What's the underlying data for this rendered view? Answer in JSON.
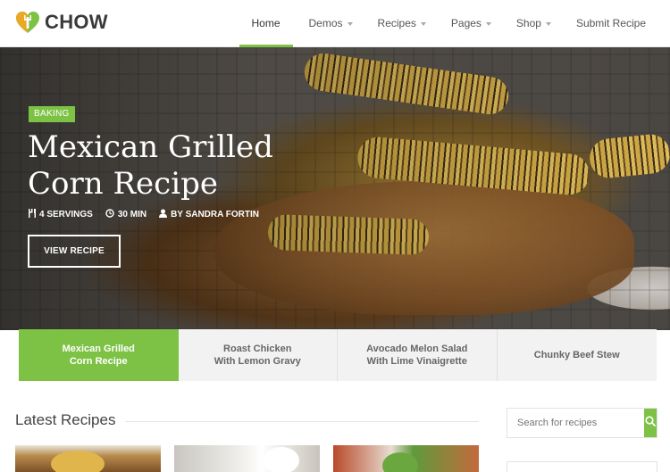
{
  "brand": {
    "name": "CHOW",
    "accent": "#7dc245"
  },
  "nav": {
    "items": [
      {
        "label": "Home",
        "active": true,
        "dropdown": false
      },
      {
        "label": "Demos",
        "active": false,
        "dropdown": true
      },
      {
        "label": "Recipes",
        "active": false,
        "dropdown": true
      },
      {
        "label": "Pages",
        "active": false,
        "dropdown": true
      },
      {
        "label": "Shop",
        "active": false,
        "dropdown": true
      },
      {
        "label": "Submit Recipe",
        "active": false,
        "dropdown": false
      }
    ]
  },
  "hero": {
    "category": "BAKING",
    "title": "Mexican Grilled Corn Recipe",
    "servings": "4 SERVINGS",
    "time": "30 MIN",
    "author": "BY SANDRA FORTIN",
    "cta": "VIEW RECIPE"
  },
  "slider_tabs": [
    {
      "line1": "Mexican Grilled",
      "line2": "Corn Recipe",
      "active": true
    },
    {
      "line1": "Roast Chicken",
      "line2": "With Lemon Gravy",
      "active": false
    },
    {
      "line1": "Avocado Melon Salad",
      "line2": "With Lime Vinaigrette",
      "active": false
    },
    {
      "line1": "Chunky Beef Stew",
      "line2": "",
      "active": false
    }
  ],
  "latest": {
    "title": "Latest Recipes"
  },
  "search": {
    "placeholder": "Search for recipes"
  },
  "icons": {
    "logo": "heart-fork-logo-icon",
    "servings": "utensils-icon",
    "time": "clock-icon",
    "author": "user-icon",
    "search": "search-icon"
  }
}
